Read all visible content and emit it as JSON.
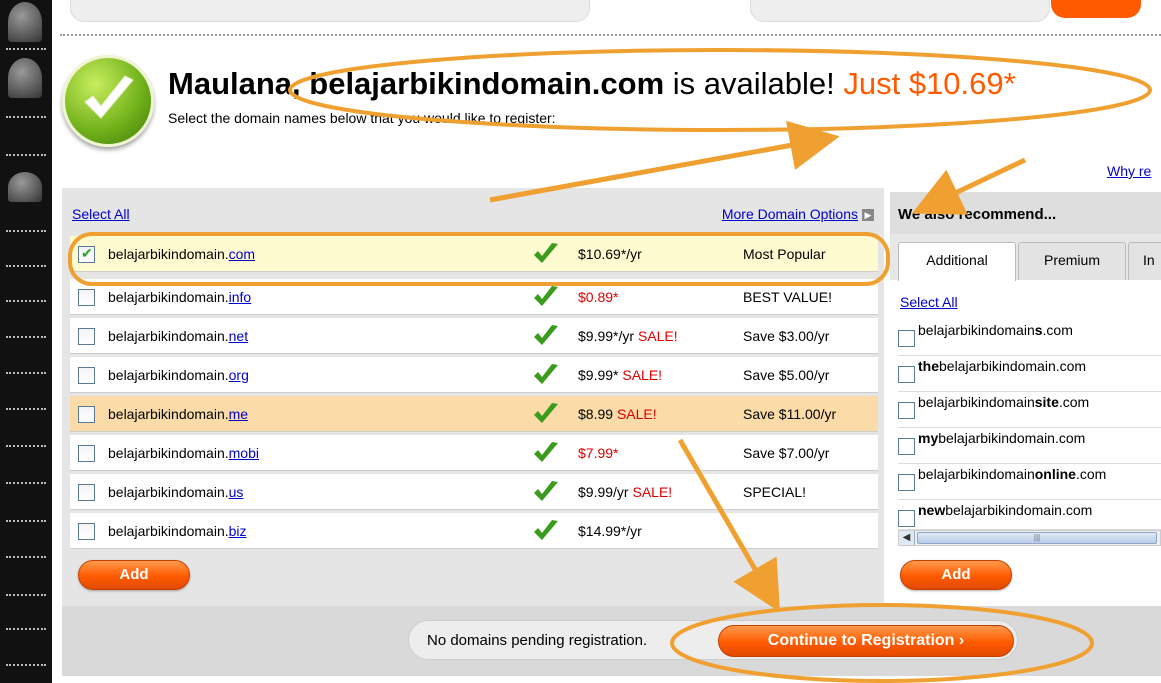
{
  "header": {
    "name_prefix": "Maulana, ",
    "domain": "belajarbikindomain.com",
    "available_text": " is available! ",
    "price_text": "Just $10.69*",
    "subtitle": "Select the domain names below that you would like to register:",
    "why_link": "Why re"
  },
  "main": {
    "select_all": "Select All",
    "more_options": "More Domain Options",
    "rows": [
      {
        "base": "belajarbikindomain.",
        "tld": "com",
        "price": "$10.69*/yr",
        "sale": "",
        "price_color": "#000000",
        "note": "Most Popular",
        "checked": true
      },
      {
        "base": "belajarbikindomain.",
        "tld": "info",
        "price": "$0.89*",
        "sale": "",
        "price_color": "#e00000",
        "note": "BEST VALUE!",
        "checked": false
      },
      {
        "base": "belajarbikindomain.",
        "tld": "net",
        "price": "$9.99*/yr ",
        "sale": "SALE!",
        "price_color": "#000000",
        "note": "Save $3.00/yr",
        "checked": false
      },
      {
        "base": "belajarbikindomain.",
        "tld": "org",
        "price": "$9.99* ",
        "sale": "SALE!",
        "price_color": "#000000",
        "note": "Save $5.00/yr",
        "checked": false
      },
      {
        "base": "belajarbikindomain.",
        "tld": "me",
        "price": "$8.99 ",
        "sale": "SALE!",
        "price_color": "#000000",
        "note": "Save $11.00/yr",
        "checked": false
      },
      {
        "base": "belajarbikindomain.",
        "tld": "mobi",
        "price": "$7.99*",
        "sale": "",
        "price_color": "#e00000",
        "note": "Save $7.00/yr",
        "checked": false
      },
      {
        "base": "belajarbikindomain.",
        "tld": "us",
        "price": "$9.99/yr ",
        "sale": "SALE!",
        "price_color": "#000000",
        "note": "SPECIAL!",
        "checked": false
      },
      {
        "base": "belajarbikindomain.",
        "tld": "biz",
        "price": "$14.99*/yr",
        "sale": "",
        "price_color": "#000000",
        "note": "",
        "checked": false
      }
    ],
    "add_label": "Add"
  },
  "footer": {
    "pending_text": "No domains pending registration.",
    "continue_label": "Continue to Registration"
  },
  "recommend": {
    "title": "We also recommend...",
    "tabs": [
      "Additional",
      "Premium",
      "In"
    ],
    "select_all": "Select All",
    "items": [
      {
        "pre": "belajarbikindomain",
        "bold": "s",
        "post": ".com"
      },
      {
        "pre": "",
        "bold": "the",
        "post": "belajarbikindomain.com"
      },
      {
        "pre": "belajarbikindomain",
        "bold": "site",
        "post": ".com"
      },
      {
        "pre": "",
        "bold": "my",
        "post": "belajarbikindomain.com"
      },
      {
        "pre": "belajarbikindomain",
        "bold": "online",
        "post": ".com"
      },
      {
        "pre": "",
        "bold": "new",
        "post": "belajarbikindomain.com"
      }
    ],
    "add_label": "Add"
  },
  "colors": {
    "accent_orange": "#ff5a00",
    "annotation_orange": "#f0a030",
    "link_blue": "#0000cc",
    "check_green": "#29a329"
  },
  "icons": [
    "available-check-icon",
    "green-tick-icon",
    "chevron-right-icon",
    "scroll-left-icon"
  ]
}
